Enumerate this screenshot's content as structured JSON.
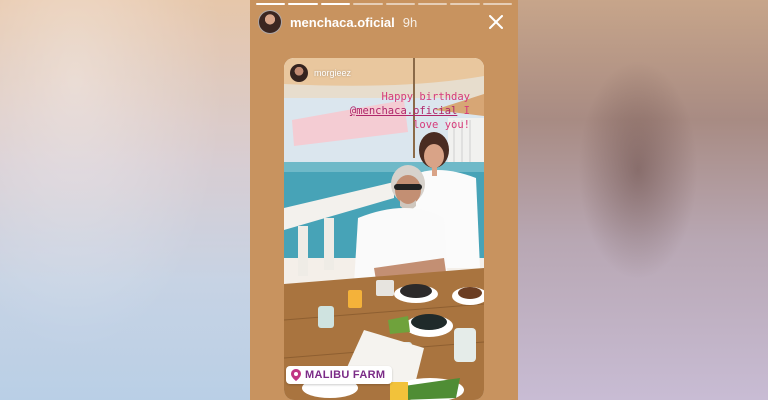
{
  "story": {
    "progress_segments": 8,
    "segments_done": 3,
    "author": {
      "username": "menchaca.oficial",
      "time": "9h"
    },
    "close_icon": "close-icon"
  },
  "repost": {
    "username": "morgieez"
  },
  "sticker": {
    "line1": "Happy birthday",
    "mention": "@menchaca.oficial",
    "line2_suffix": "I",
    "line3": "love you!"
  },
  "location": {
    "icon": "location-pin-icon",
    "label": "MALIBU FARM"
  },
  "colors": {
    "story_bg": "#c8935f",
    "sticker_text": "#d63a7a",
    "location_text": "#7b2b87"
  }
}
